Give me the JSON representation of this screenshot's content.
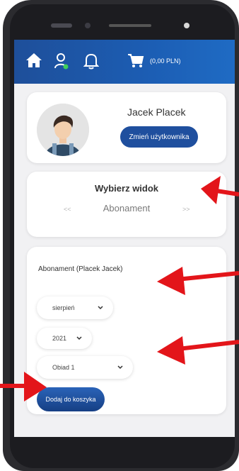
{
  "header": {
    "cart_total": "(0,00 PLN)",
    "icons": [
      "home-icon",
      "user-icon",
      "bell-icon",
      "cart-icon"
    ]
  },
  "profile": {
    "name": "Jacek Placek",
    "change_user_label": "Zmień użytkownika"
  },
  "view_selector": {
    "title": "Wybierz widok",
    "prev_label": "<<",
    "current": "Abonament",
    "next_label": ">>"
  },
  "subscription": {
    "title": "Abonament (Placek Jacek)",
    "month": "sierpień",
    "year": "2021",
    "meal": "Obiad 1",
    "add_label": "Dodaj do koszyka"
  },
  "colors": {
    "header": "#1c5db3",
    "primary_button": "#1f4f9e",
    "annotation_arrow": "#e3151a",
    "background": "#f1f1f3"
  }
}
